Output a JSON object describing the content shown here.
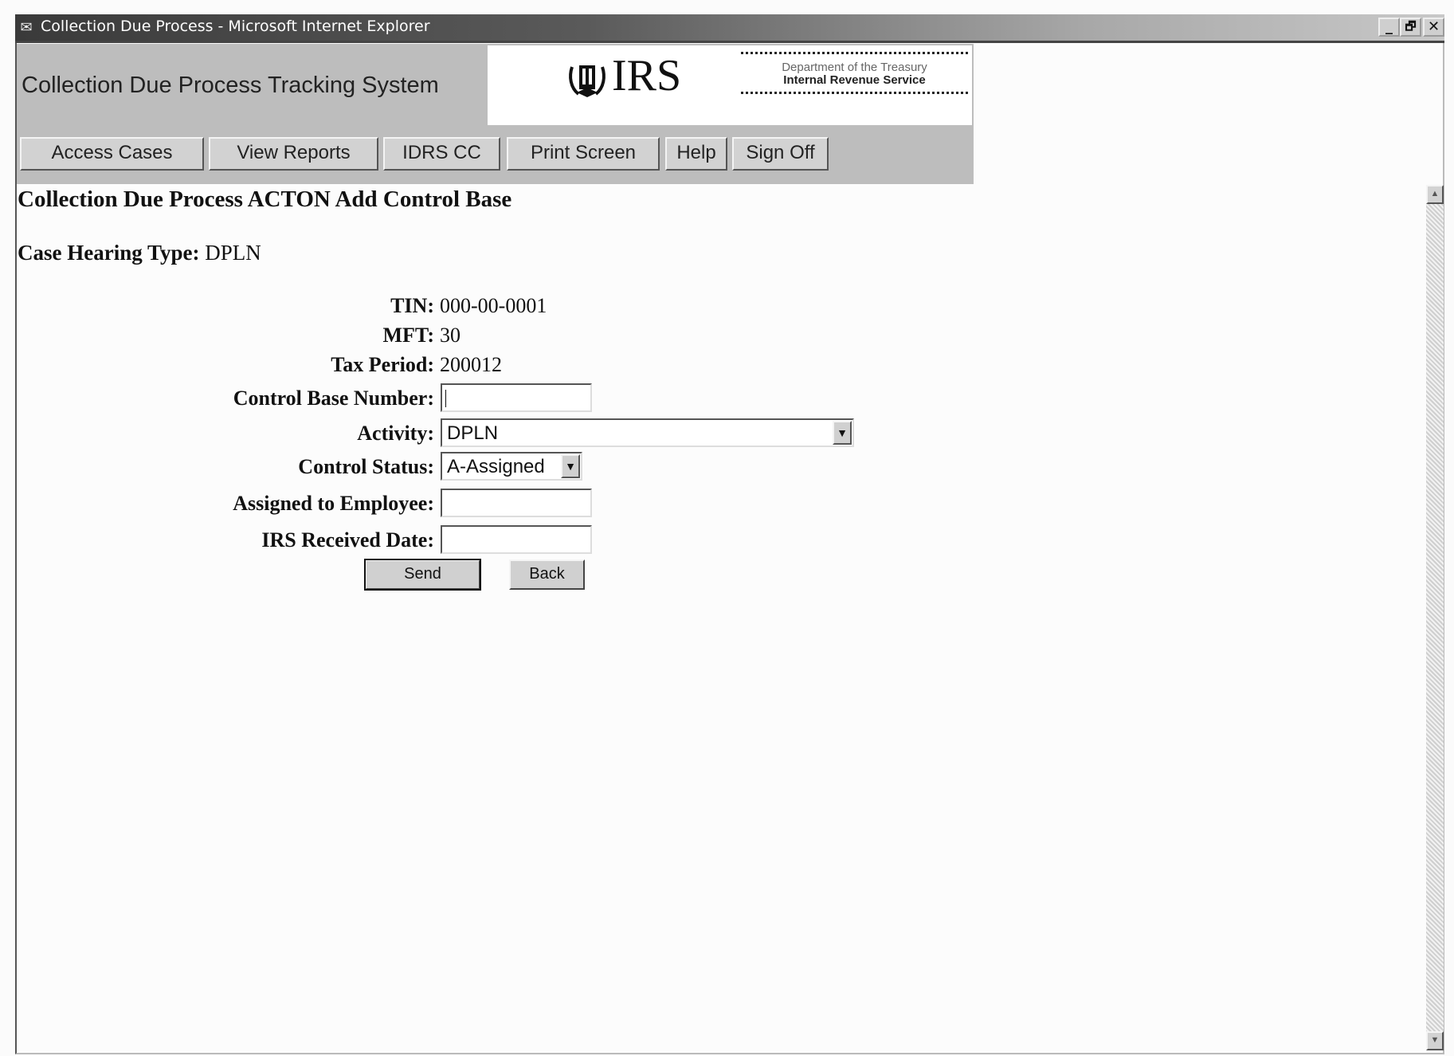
{
  "window": {
    "title": "Collection Due Process - Microsoft Internet Explorer",
    "app_icon": "ie-page-icon",
    "controls": {
      "minimize": "_",
      "restore": "🗗",
      "close": "✕"
    }
  },
  "header": {
    "system_title": "Collection Due Process Tracking System",
    "logo_text": "IRS",
    "dept_line1": "Department of the Treasury",
    "dept_line2": "Internal Revenue Service"
  },
  "nav": {
    "buttons": [
      "Access Cases",
      "View Reports",
      "IDRS CC",
      "Print Screen",
      "Help",
      "Sign Off"
    ]
  },
  "page": {
    "title": "Collection Due Process ACTON Add Control Base",
    "hearing_label": "Case Hearing Type:",
    "hearing_value": "DPLN"
  },
  "form": {
    "tin": {
      "label": "TIN:",
      "value": "000-00-0001"
    },
    "mft": {
      "label": "MFT:",
      "value": "30"
    },
    "tax_period": {
      "label": "Tax Period:",
      "value": "200012"
    },
    "control_base_number": {
      "label": "Control Base Number:",
      "value": ""
    },
    "activity": {
      "label": "Activity:",
      "selected": "DPLN"
    },
    "control_status": {
      "label": "Control Status:",
      "selected": "A-Assigned"
    },
    "assigned_employee": {
      "label": "Assigned to Employee:",
      "value": ""
    },
    "irs_received_date": {
      "label": "IRS Received Date:",
      "value": ""
    },
    "send_label": "Send",
    "back_label": "Back"
  }
}
